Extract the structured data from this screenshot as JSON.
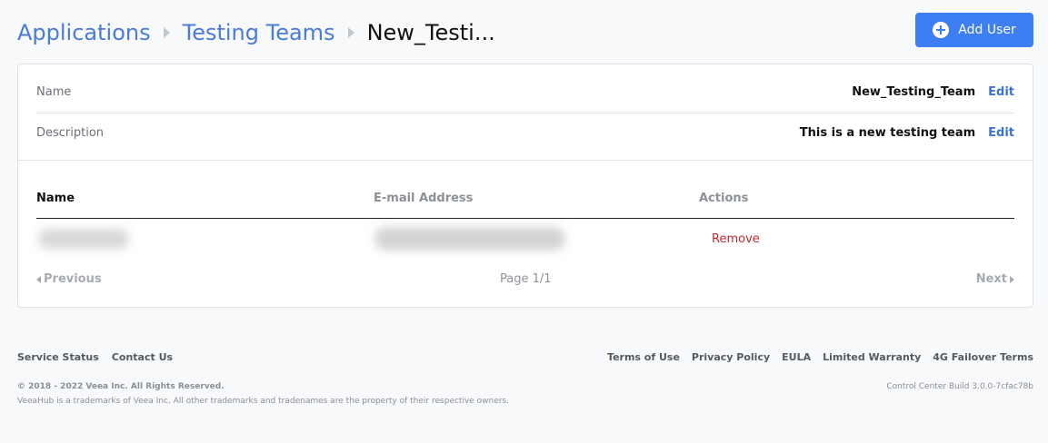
{
  "breadcrumb": {
    "items": [
      "Applications",
      "Testing Teams"
    ],
    "current": "New_Testi..."
  },
  "header": {
    "add_user_label": "Add User"
  },
  "team": {
    "name_label": "Name",
    "name_value": "New_Testing_Team",
    "description_label": "Description",
    "description_value": "This is a new testing team",
    "edit_label": "Edit"
  },
  "table": {
    "columns": [
      "Name",
      "E-mail Address",
      "Actions"
    ],
    "rows": [
      {
        "name": "",
        "email": "",
        "action": "Remove"
      }
    ]
  },
  "pager": {
    "previous": "Previous",
    "page": "Page 1/1",
    "next": "Next"
  },
  "footer": {
    "left_links": [
      "Service Status",
      "Contact Us"
    ],
    "right_links": [
      "Terms of Use",
      "Privacy Policy",
      "EULA",
      "Limited Warranty",
      "4G Failover Terms"
    ],
    "copyright": "© 2018 - 2022 Veea Inc. All Rights Reserved.",
    "trademark": "VeeaHub is a trademarks of Veea Inc. All other trademarks and tradenames are the property of their respective owners.",
    "build": "Control Center Build 3.0.0-7cfac78b"
  },
  "colors": {
    "accent": "#3d7ef2",
    "link": "#4a7bd6",
    "danger": "#c0282d",
    "background": "#f8f9fb"
  },
  "icons": [
    "chevron-right-icon",
    "plus-circle-icon",
    "caret-left-icon",
    "caret-right-icon"
  ]
}
